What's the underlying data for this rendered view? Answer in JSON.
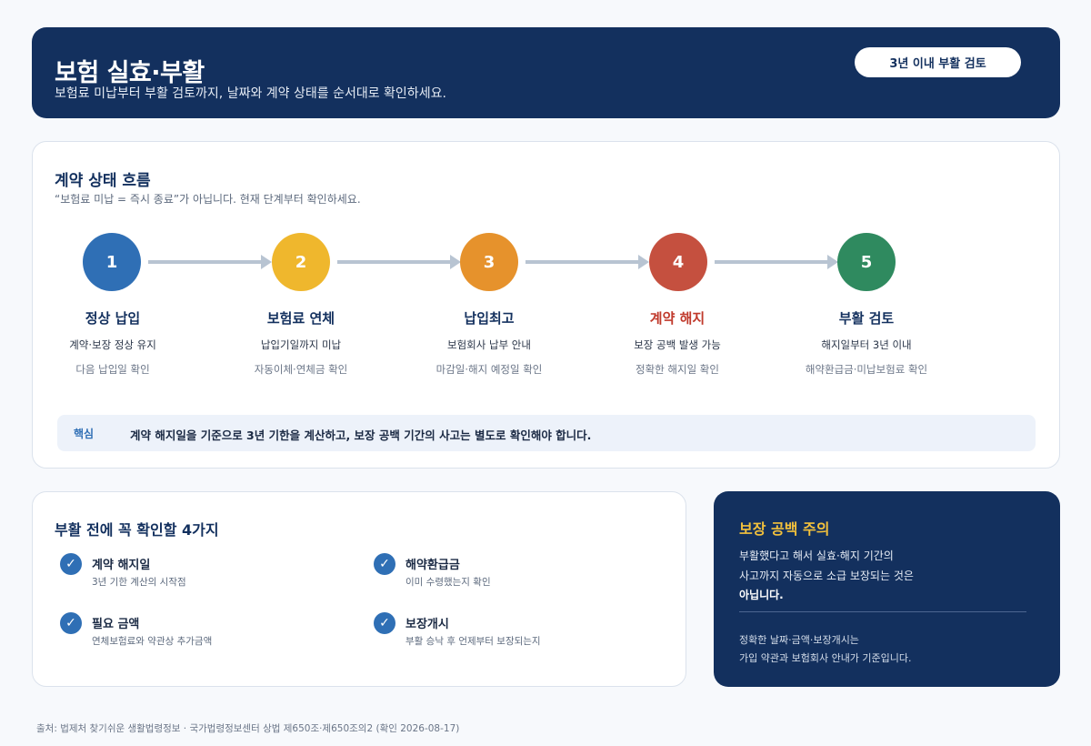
{
  "header": {
    "title": "보험 실효·부활",
    "subtitle": "보험료 미납부터 부활 검토까지, 날짜와 계약 상태를 순서대로 확인하세요.",
    "badge": "3년 이내 부활 검토"
  },
  "flow": {
    "title": "계약 상태 흐름",
    "desc": "“보험료 미납 = 즉시 종료”가 아닙니다. 현재 단계부터 확인하세요.",
    "steps": [
      {
        "num": "1",
        "title": "정상 납입",
        "line1": "계약·보장 정상 유지",
        "line2": "다음 납입일 확인",
        "color": "#2f6fb5"
      },
      {
        "num": "2",
        "title": "보험료 연체",
        "line1": "납입기일까지 미납",
        "line2": "자동이체·연체금 확인",
        "color": "#efb72d"
      },
      {
        "num": "3",
        "title": "납입최고",
        "line1": "보험회사 납부 안내",
        "line2": "마감일·해지 예정일 확인",
        "color": "#e6922c"
      },
      {
        "num": "4",
        "title": "계약 해지",
        "line1": "보장 공백 발생 가능",
        "line2": "정확한 해지일 확인",
        "color": "#c5503f"
      },
      {
        "num": "5",
        "title": "부활 검토",
        "line1": "해지일부터 3년 이내",
        "line2": "해약환급금·미납보험료 확인",
        "color": "#2f8a5f"
      }
    ],
    "key_label": "핵심",
    "key_text": "계약 해지일을 기준으로 3년 기한을 계산하고, 보장 공백 기간의 사고는 별도로 확인해야 합니다."
  },
  "checklist": {
    "title": "부활 전에 꼭 확인할 4가지",
    "items": [
      {
        "title": "계약 해지일",
        "desc": "3년 기한 계산의 시작점"
      },
      {
        "title": "해약환급금",
        "desc": "이미 수령했는지 확인"
      },
      {
        "title": "필요 금액",
        "desc": "연체보험료와 약관상 추가금액"
      },
      {
        "title": "보장개시",
        "desc": "부활 승낙 후 언제부터 보장되는지"
      }
    ],
    "check_glyph": "✓"
  },
  "warning": {
    "title": "보장 공백 주의",
    "line1": "부활했다고 해서 실효·해지 기간의",
    "line2": "사고까지 자동으로 소급 보장되는 것은",
    "line3": "아닙니다.",
    "note1": "정확한 날짜·금액·보장개시는",
    "note2": "가입 약관과 보험회사 안내가 기준입니다."
  },
  "source": "출처: 법제처 찾기쉬운 생활법령정보 · 국가법령정보센터 상법 제650조·제650조의2 (확인 2026-08-17)"
}
